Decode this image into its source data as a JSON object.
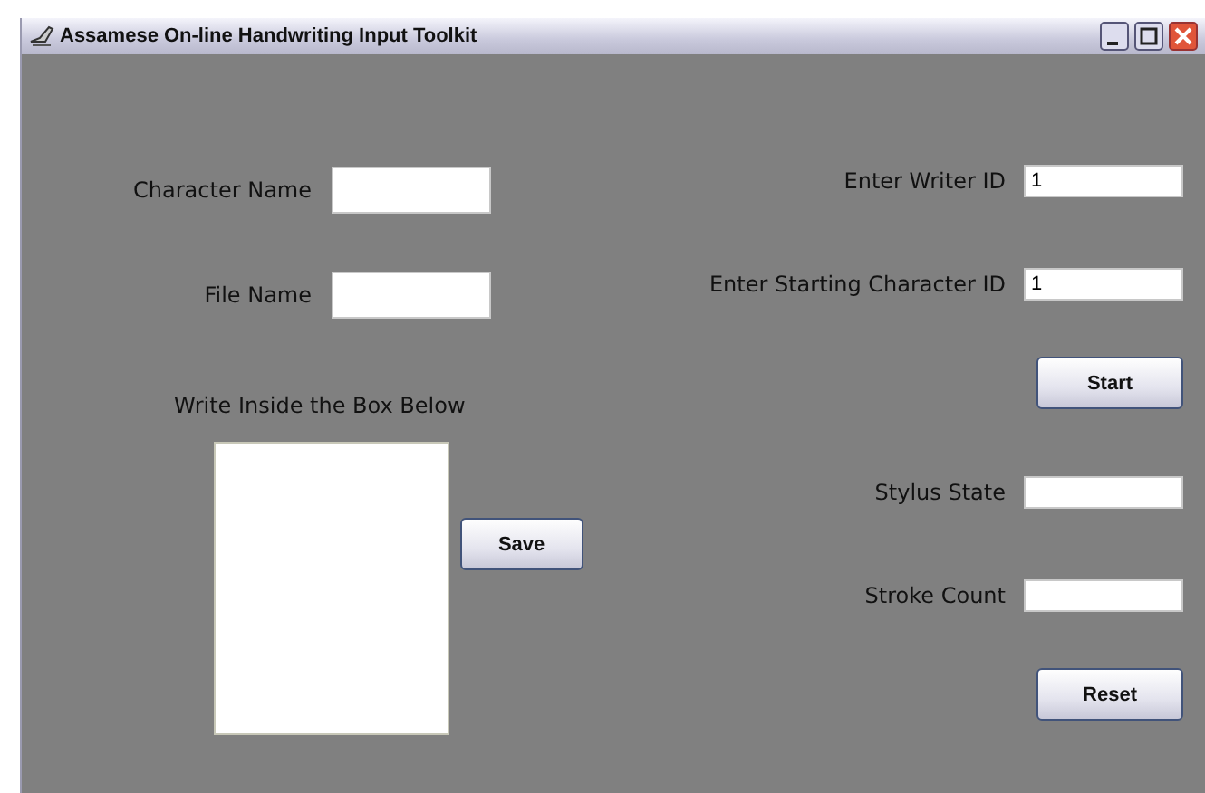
{
  "window": {
    "title": "Assamese On-line Handwriting Input Toolkit"
  },
  "left_fields": [
    {
      "label": "Character Name"
    },
    {
      "label": "File Name"
    }
  ],
  "canvas": {
    "label": "Write Inside the Box Below"
  },
  "save_button": "Save",
  "right_fields": [
    {
      "label": "Enter Writer ID",
      "value": "1",
      "kind": "field"
    },
    {
      "label": "Enter Starting Character ID",
      "value": "1",
      "kind": "field"
    },
    {
      "label": "Start",
      "kind": "button"
    },
    {
      "label": "Stylus State",
      "kind": "field"
    },
    {
      "label": "Stroke Count",
      "kind": "field"
    },
    {
      "label": "Reset",
      "kind": "button"
    }
  ]
}
